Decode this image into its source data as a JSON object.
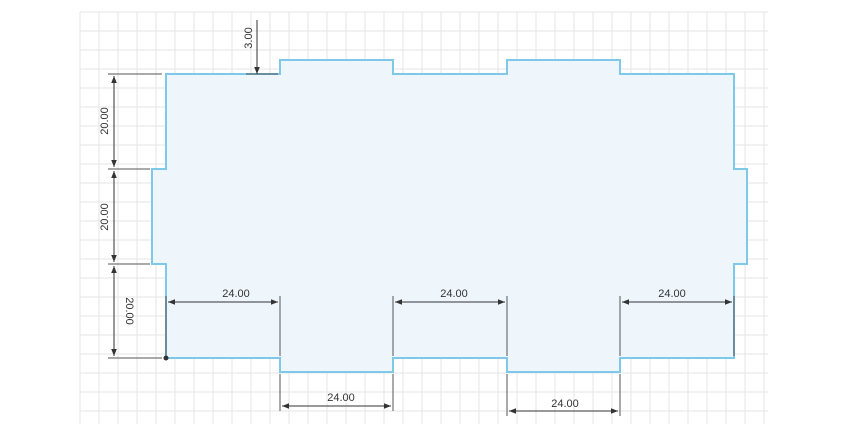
{
  "dimensions": {
    "top_notch_height": "3.00",
    "left_upper_height": "20.00",
    "left_middle_height": "20.00",
    "left_lower_height": "20.00",
    "inner_width_1": "24.00",
    "inner_width_2": "24.00",
    "inner_width_3": "24.00",
    "bottom_width_1": "24.00",
    "bottom_width_2": "24.00"
  },
  "colors": {
    "shape_fill": "#eef6fc",
    "shape_stroke": "#7ec8e8",
    "grid": "#e6e6e6",
    "dimension": "#333333"
  }
}
